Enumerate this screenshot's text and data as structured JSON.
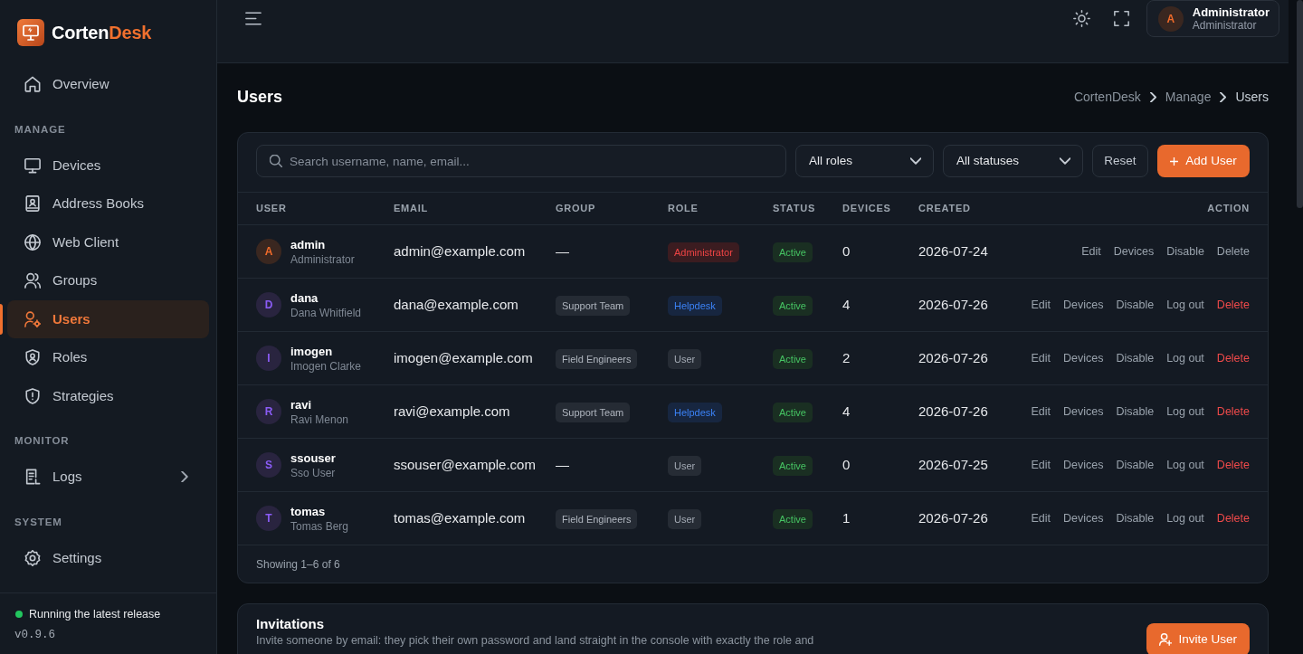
{
  "sidebar": {
    "brand": {
      "primary": "Corten",
      "accent": "Desk"
    },
    "sections": [
      {
        "items": [
          {
            "label": "Overview",
            "selected": false
          }
        ]
      },
      {
        "title": "MANAGE",
        "items": [
          {
            "label": "Devices",
            "selected": false
          },
          {
            "label": "Address Books",
            "selected": false
          },
          {
            "label": "Web Client",
            "selected": false
          },
          {
            "label": "Groups",
            "selected": false
          },
          {
            "label": "Users",
            "selected": true
          },
          {
            "label": "Roles",
            "selected": false
          },
          {
            "label": "Strategies",
            "selected": false
          }
        ]
      },
      {
        "title": "MONITOR",
        "items": [
          {
            "label": "Logs",
            "selected": false,
            "expanded": false
          }
        ]
      },
      {
        "title": "SYSTEM",
        "items": [
          {
            "label": "Settings",
            "selected": false
          }
        ]
      }
    ],
    "footer": {
      "status": "Running the latest release",
      "version": "v0.9.6"
    }
  },
  "header": {
    "user": {
      "avatar": "A",
      "name": "Administrator",
      "role": "Administrator"
    }
  },
  "page": {
    "title": "Users",
    "breadcrumb": [
      "CortenDesk",
      "Manage",
      "Users"
    ]
  },
  "users_card": {
    "search": {
      "placeholder": "Search username, name, email..."
    },
    "filters": [
      "All roles",
      "All statuses"
    ],
    "reset_button": "Reset",
    "add_button": "Add User",
    "table": {
      "columns": [
        "USER",
        "EMAIL",
        "GROUP",
        "ROLE",
        "STATUS",
        "DEVICES",
        "CREATED",
        "ACTION"
      ],
      "rows": [
        {
          "avatar": "A",
          "username": "admin",
          "full_name": "Administrator",
          "email": "admin@example.com",
          "group": {
            "label": "—",
            "kind": "empty"
          },
          "role": {
            "label": "Administrator",
            "kind": "admin"
          },
          "status": "Active",
          "devices": "0",
          "created": "2026-07-24",
          "actions": [
            {
              "label": "Edit",
              "kind": "plain"
            },
            {
              "label": "Devices",
              "kind": "plain"
            },
            {
              "label": "Disable",
              "kind": "plain"
            },
            {
              "label": "Delete",
              "kind": "plain"
            }
          ]
        },
        {
          "avatar": "D",
          "username": "dana",
          "full_name": "Dana Whitfield",
          "email": "dana@example.com",
          "group": {
            "label": "Support Team",
            "kind": "tag"
          },
          "role": {
            "label": "Helpdesk",
            "kind": "helpdesk"
          },
          "status": "Active",
          "devices": "4",
          "created": "2026-07-26",
          "actions": [
            {
              "label": "Edit",
              "kind": "plain"
            },
            {
              "label": "Devices",
              "kind": "plain"
            },
            {
              "label": "Disable",
              "kind": "plain"
            },
            {
              "label": "Log out",
              "kind": "plain"
            },
            {
              "label": "Delete",
              "kind": "danger"
            }
          ]
        },
        {
          "avatar": "I",
          "username": "imogen",
          "full_name": "Imogen Clarke",
          "email": "imogen@example.com",
          "group": {
            "label": "Field Engineers",
            "kind": "tag"
          },
          "role": {
            "label": "User",
            "kind": "user"
          },
          "status": "Active",
          "devices": "2",
          "created": "2026-07-26",
          "actions": [
            {
              "label": "Edit",
              "kind": "plain"
            },
            {
              "label": "Devices",
              "kind": "plain"
            },
            {
              "label": "Disable",
              "kind": "plain"
            },
            {
              "label": "Log out",
              "kind": "plain"
            },
            {
              "label": "Delete",
              "kind": "danger"
            }
          ]
        },
        {
          "avatar": "R",
          "username": "ravi",
          "full_name": "Ravi Menon",
          "email": "ravi@example.com",
          "group": {
            "label": "Support Team",
            "kind": "tag"
          },
          "role": {
            "label": "Helpdesk",
            "kind": "helpdesk"
          },
          "status": "Active",
          "devices": "4",
          "created": "2026-07-26",
          "actions": [
            {
              "label": "Edit",
              "kind": "plain"
            },
            {
              "label": "Devices",
              "kind": "plain"
            },
            {
              "label": "Disable",
              "kind": "plain"
            },
            {
              "label": "Log out",
              "kind": "plain"
            },
            {
              "label": "Delete",
              "kind": "danger"
            }
          ]
        },
        {
          "avatar": "S",
          "username": "ssouser",
          "full_name": "Sso User",
          "email": "ssouser@example.com",
          "group": {
            "label": "—",
            "kind": "empty"
          },
          "role": {
            "label": "User",
            "kind": "user"
          },
          "status": "Active",
          "devices": "0",
          "created": "2026-07-25",
          "actions": [
            {
              "label": "Edit",
              "kind": "plain"
            },
            {
              "label": "Devices",
              "kind": "plain"
            },
            {
              "label": "Disable",
              "kind": "plain"
            },
            {
              "label": "Log out",
              "kind": "plain"
            },
            {
              "label": "Delete",
              "kind": "danger"
            }
          ]
        },
        {
          "avatar": "T",
          "username": "tomas",
          "full_name": "Tomas Berg",
          "email": "tomas@example.com",
          "group": {
            "label": "Field Engineers",
            "kind": "tag"
          },
          "role": {
            "label": "User",
            "kind": "user"
          },
          "status": "Active",
          "devices": "1",
          "created": "2026-07-26",
          "actions": [
            {
              "label": "Edit",
              "kind": "plain"
            },
            {
              "label": "Devices",
              "kind": "plain"
            },
            {
              "label": "Disable",
              "kind": "plain"
            },
            {
              "label": "Log out",
              "kind": "plain"
            },
            {
              "label": "Delete",
              "kind": "danger"
            }
          ]
        }
      ]
    },
    "footer": "Showing 1–6 of 6"
  },
  "invitations": {
    "title": "Invitations",
    "description": "Invite someone by email: they pick their own password and land straight in the console with exactly the role and",
    "button": "Invite User"
  }
}
